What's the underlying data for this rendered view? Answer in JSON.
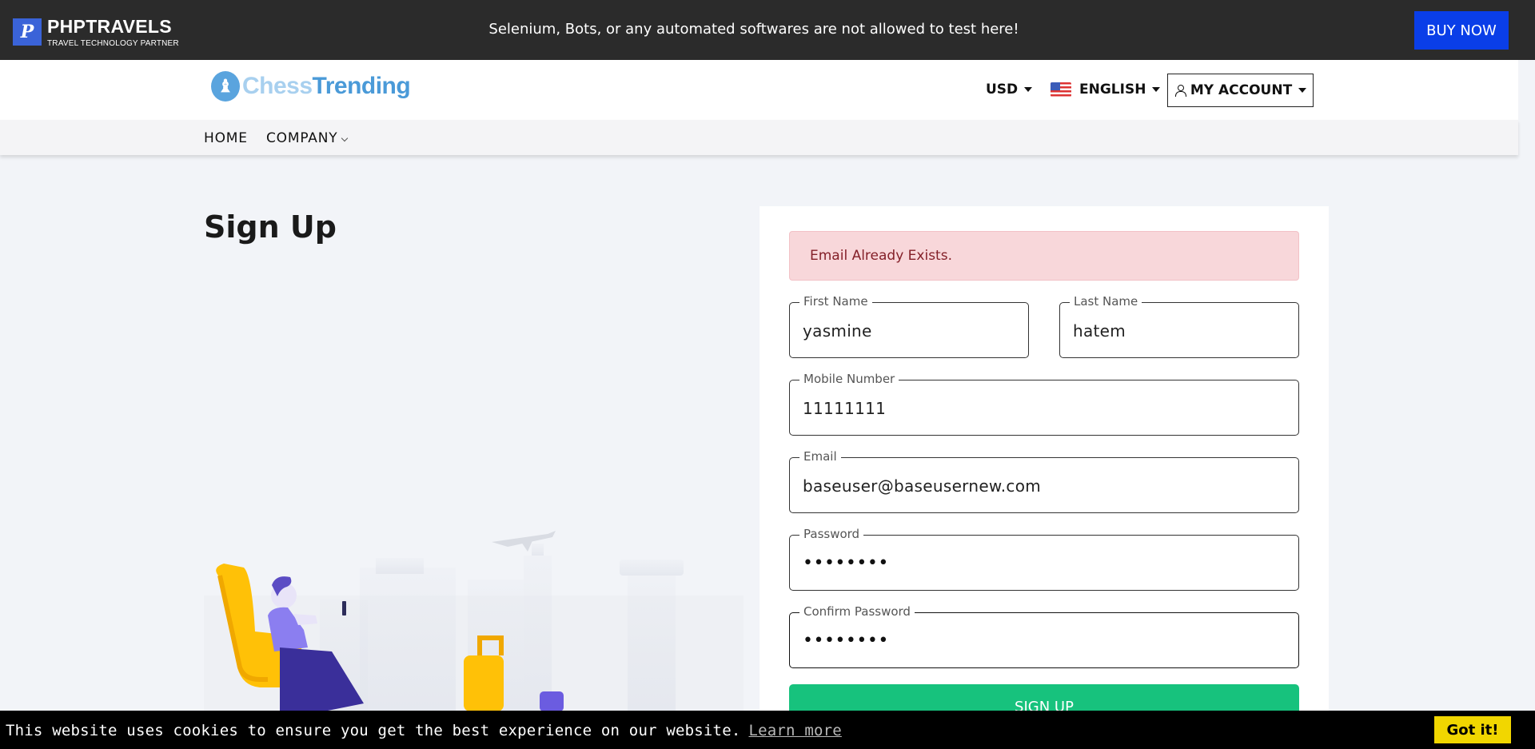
{
  "topbar": {
    "brand_name": "PHPTRAVELS",
    "brand_tagline": "TRAVEL TECHNOLOGY PARTNER",
    "warning": "Selenium, Bots, or any automated softwares are not allowed to test here!",
    "buy_now": "BUY NOW"
  },
  "header": {
    "logo_part1": "Chess",
    "logo_part2": "Trending",
    "currency": "USD",
    "language": "ENGLISH",
    "account": "MY ACCOUNT"
  },
  "nav": {
    "home": "HOME",
    "company": "COMPANY"
  },
  "page": {
    "title": "Sign Up"
  },
  "form": {
    "alert": "Email Already Exists.",
    "first_name": {
      "label": "First Name",
      "value": "yasmine"
    },
    "last_name": {
      "label": "Last Name",
      "value": "hatem"
    },
    "mobile": {
      "label": "Mobile Number",
      "value": "11111111"
    },
    "email": {
      "label": "Email",
      "value": "baseuser@baseusernew.com"
    },
    "password": {
      "label": "Password",
      "value": "••••••••"
    },
    "confirm_password": {
      "label": "Confirm Password",
      "value": "••••••••"
    },
    "submit": "SIGN UP"
  },
  "cookie": {
    "message": "This website uses cookies to ensure you get the best experience on our website.",
    "learn_more": "Learn more",
    "accept": "Got it!"
  },
  "colors": {
    "topbar": "#2b2b2b",
    "buy_now": "#0a3ee8",
    "signup_button": "#17c27d",
    "alert_bg": "#f8d7da",
    "cookie_accept": "#f1d600"
  }
}
